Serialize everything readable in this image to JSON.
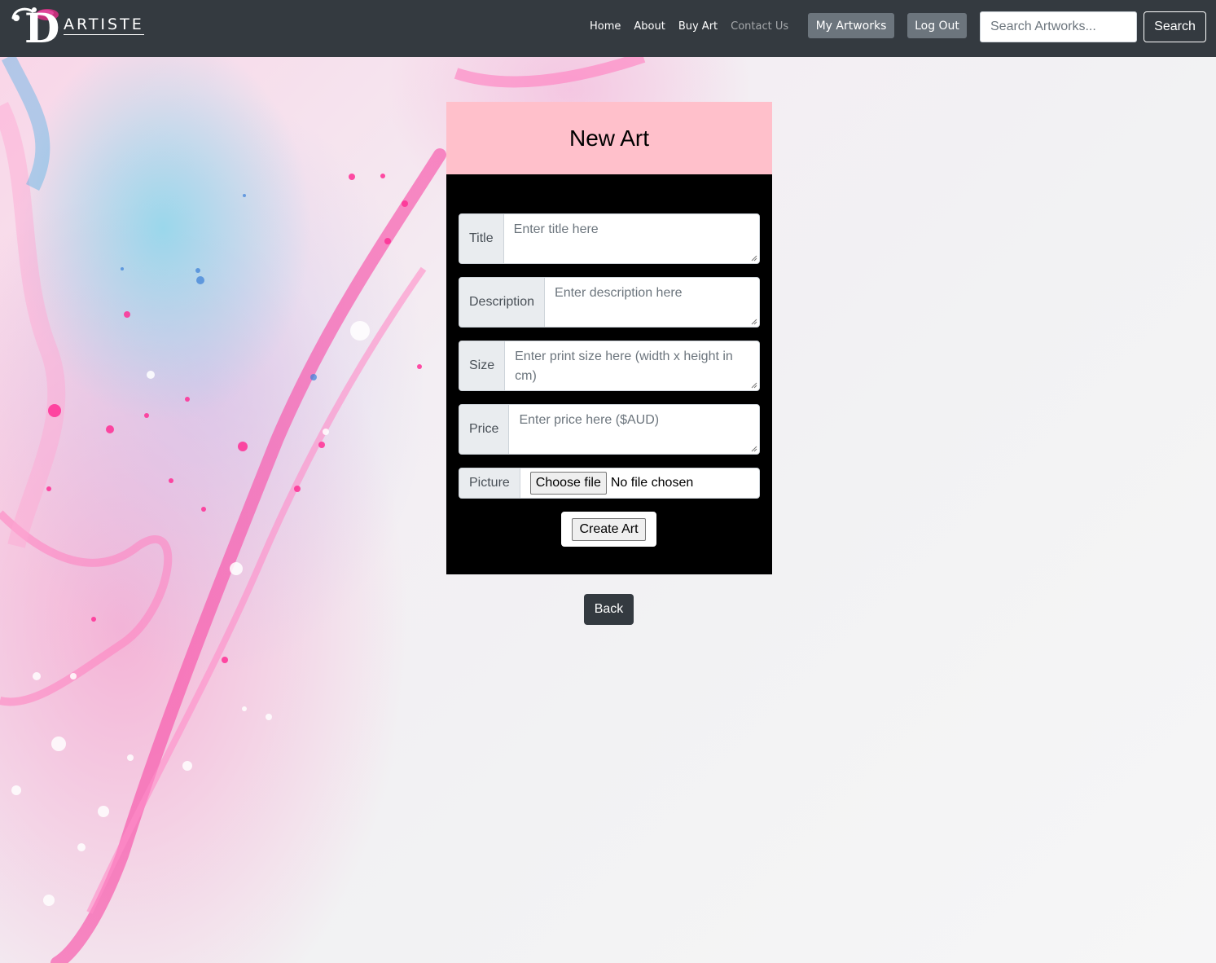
{
  "navbar": {
    "brand_text": "ARTISTE",
    "brand_letter": "D",
    "links": [
      {
        "label": "Home",
        "muted": false
      },
      {
        "label": "About",
        "muted": false
      },
      {
        "label": "Buy Art",
        "muted": false
      },
      {
        "label": "Contact Us",
        "muted": true
      }
    ],
    "my_artworks_label": "My Artworks",
    "logout_label": "Log Out",
    "search_placeholder": "Search Artworks...",
    "search_button_label": "Search"
  },
  "form": {
    "title": "New Art",
    "fields": [
      {
        "label": "Title",
        "placeholder": "Enter title here",
        "value": ""
      },
      {
        "label": "Description",
        "placeholder": "Enter description here",
        "value": ""
      },
      {
        "label": "Size",
        "placeholder": "Enter print size here (width x height in cm)",
        "value": ""
      },
      {
        "label": "Price",
        "placeholder": "Enter price here ($AUD)",
        "value": ""
      }
    ],
    "picture": {
      "label": "Picture",
      "button_label": "Choose file",
      "status": "No file chosen"
    },
    "submit_label": "Create Art"
  },
  "back_label": "Back",
  "colors": {
    "navbar_bg": "#343a40",
    "card_header_bg": "#ffc0cb",
    "card_body_bg": "#000000",
    "button_gray": "#6c757d",
    "back_button_bg": "#343a40"
  }
}
